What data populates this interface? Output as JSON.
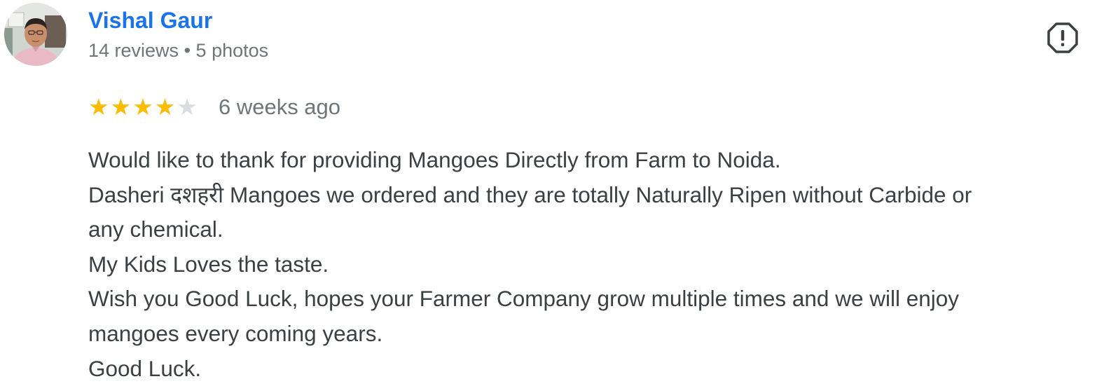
{
  "author": {
    "name": "Vishal Gaur",
    "reviews": "14 reviews",
    "separator": "•",
    "photos": "5 photos"
  },
  "rating": {
    "value": 4,
    "max": 5,
    "star_glyph": "★",
    "filled_color": "#fbbc04",
    "empty_color": "#dadce0"
  },
  "date": "6 weeks ago",
  "review_lines": [
    "Would like to thank for providing Mangoes Directly from Farm to Noida.",
    "Dasheri दशहरी Mangoes we ordered and they are totally Naturally Ripen without Carbide or",
    "any chemical.",
    "My Kids Loves the taste.",
    "Wish you Good Luck, hopes your Farmer Company grow multiple times and we will enjoy",
    "mangoes every coming years.",
    "Good Luck."
  ],
  "colors": {
    "name": "#1a73e8",
    "meta": "#70757a",
    "text": "#3c4043"
  },
  "icons": {
    "report": "report-flag-icon"
  }
}
